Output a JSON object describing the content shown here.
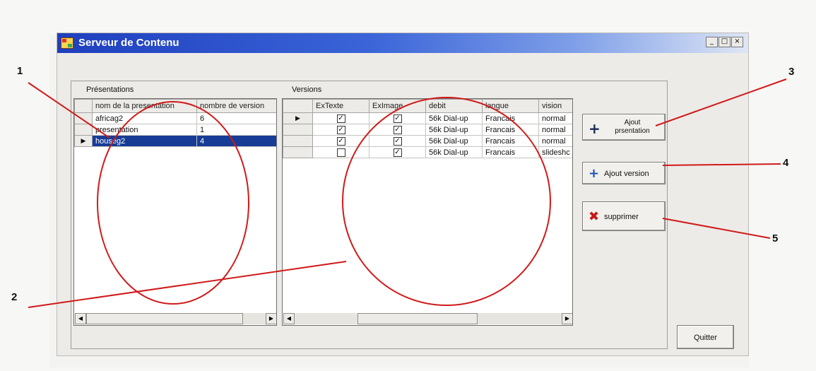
{
  "window": {
    "title": "Serveur de Contenu",
    "controls": {
      "minimize": "_",
      "maximize": "□",
      "close": "×"
    }
  },
  "presentations": {
    "group_label": "Présentations",
    "columns": [
      "nom de la presentation",
      "nombre de version"
    ],
    "rows": [
      {
        "name": "africag2",
        "count": "6",
        "selected": false
      },
      {
        "name": "presentation",
        "count": "1",
        "selected": false
      },
      {
        "name": "houseg2",
        "count": "4",
        "selected": true
      }
    ]
  },
  "versions": {
    "group_label": "Versions",
    "columns": [
      "ExTexte",
      "ExImage",
      "debit",
      "langue",
      "vision"
    ],
    "rows": [
      {
        "extexte": true,
        "eximage": true,
        "debit": "56k Dial-up",
        "langue": "Francais",
        "vision": "normal",
        "current": true
      },
      {
        "extexte": true,
        "eximage": true,
        "debit": "56k Dial-up",
        "langue": "Francais",
        "vision": "normal",
        "current": false
      },
      {
        "extexte": true,
        "eximage": true,
        "debit": "56k Dial-up",
        "langue": "Francais",
        "vision": "normal",
        "current": false
      },
      {
        "extexte": false,
        "eximage": true,
        "debit": "56k Dial-up",
        "langue": "Francais",
        "vision": "slideshc",
        "current": false
      }
    ]
  },
  "buttons": {
    "ajout_presentation": "Ajout\nprsentation",
    "ajout_version": "Ajout version",
    "supprimer": "supprimer",
    "quitter": "Quitter"
  },
  "glyphs": {
    "row_pointer": "▶",
    "check": "✓",
    "arrow_left": "◀",
    "arrow_right": "▶",
    "plus": "+",
    "cross": "✖"
  },
  "annotations": {
    "labels": [
      "1",
      "2",
      "3",
      "4",
      "5"
    ],
    "color": "#d01a1a"
  },
  "colors": {
    "selection": "#163c96",
    "title_bar": "#2a4fcc"
  }
}
